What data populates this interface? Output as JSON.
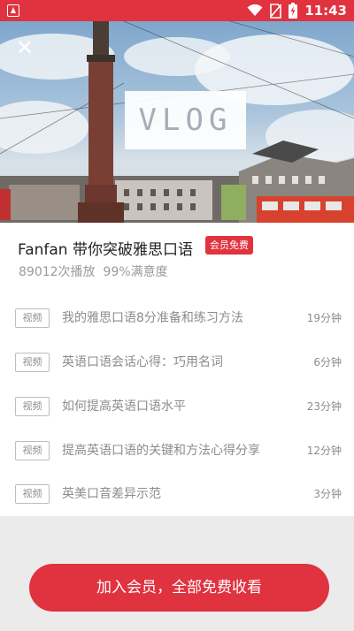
{
  "status_bar": {
    "time": "11:43",
    "notification_icon": "app-notification-icon",
    "wifi_icon": "wifi-icon",
    "no_sim_icon": "no-sim-icon",
    "battery_icon": "battery-charging-icon"
  },
  "hero": {
    "close_icon": "close-icon",
    "close_glyph": "✕",
    "overlay_text": "VLOG"
  },
  "course": {
    "title": "Fanfan 带你突破雅思口语",
    "badge": "会员免费",
    "plays": "89012次播放",
    "satisfaction": "99%满意度"
  },
  "lessons": [
    {
      "tag": "视频",
      "title": "我的雅思口语8分准备和练习方法",
      "duration": "19分钟"
    },
    {
      "tag": "视频",
      "title": "英语口语会话心得：巧用名词",
      "duration": "6分钟"
    },
    {
      "tag": "视频",
      "title": "如何提高英语口语水平",
      "duration": "23分钟"
    },
    {
      "tag": "视频",
      "title": "提高英语口语的关键和方法心得分享",
      "duration": "12分钟"
    },
    {
      "tag": "视频",
      "title": "英美口音差异示范",
      "duration": "3分钟"
    }
  ],
  "cta": {
    "label": "加入会员，全部免费收看"
  },
  "colors": {
    "accent": "#e0323f",
    "muted_text": "#8c8c8c"
  }
}
